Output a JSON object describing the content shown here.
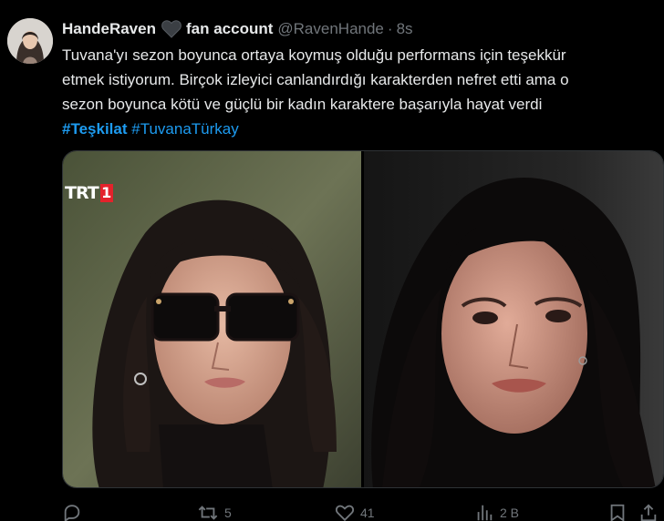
{
  "tweet": {
    "display_name": "HandeRaven",
    "emoji_name": "black-heart-icon",
    "name_suffix": "fan account",
    "handle": "@RavenHande",
    "separator": "·",
    "time": "8s",
    "text_lines": [
      "Tuvana'yı sezon boyunca ortaya koymuş olduğu performans için teşekkür",
      "etmek istiyorum. Birçok izleyici canlandırdığı karakterden nefret etti ama o",
      "sezon boyunca kötü ve güçlü bir kadın karaktere başarıyla hayat verdi"
    ],
    "hashtags": [
      "#Teşkilat",
      "#TuvanaTürkay"
    ],
    "media_watermark": {
      "text": "TRT",
      "box": "1"
    }
  },
  "actions": {
    "reply": {
      "icon": "reply-icon",
      "count": ""
    },
    "retweet": {
      "icon": "retweet-icon",
      "count": "5"
    },
    "like": {
      "icon": "heart-icon",
      "count": "41"
    },
    "views": {
      "icon": "views-icon",
      "count": "2 B"
    },
    "bookmark": {
      "icon": "bookmark-icon",
      "count": ""
    },
    "share": {
      "icon": "share-icon",
      "count": ""
    }
  },
  "colors": {
    "background": "#000000",
    "text": "#e7e9ea",
    "muted": "#71767b",
    "link": "#1d9bf0",
    "border": "#2f3336"
  }
}
